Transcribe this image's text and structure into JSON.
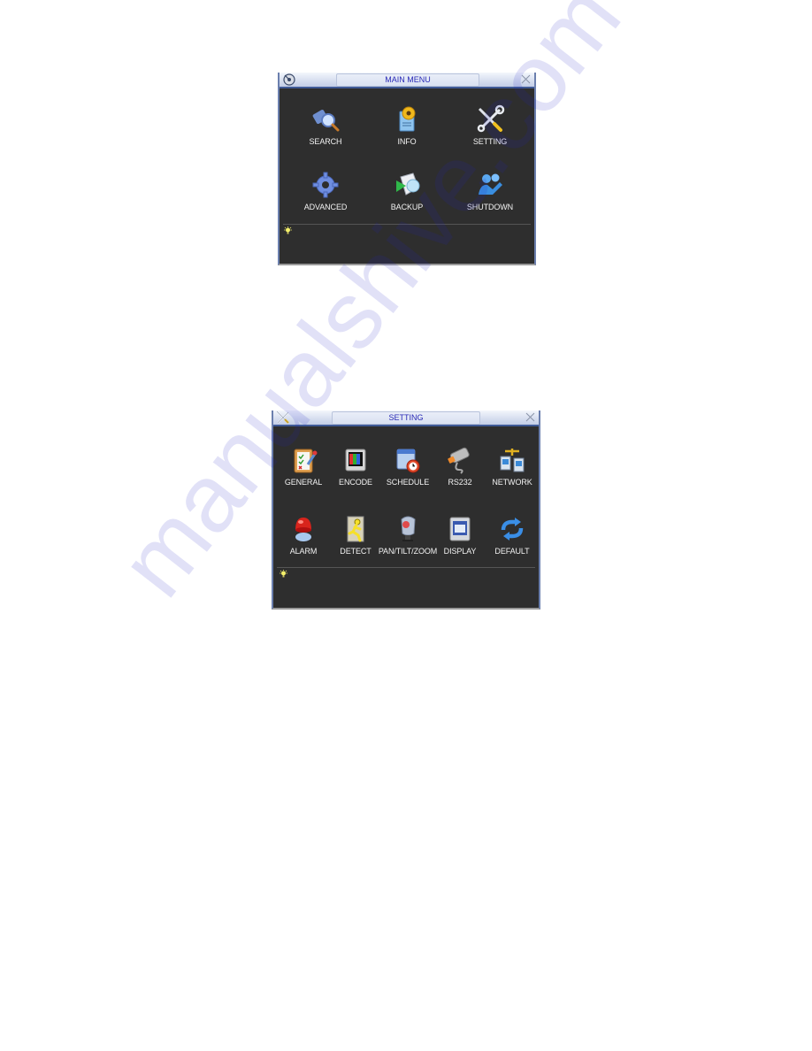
{
  "main_menu": {
    "title": "MAIN MENU",
    "title_icon": "disc-icon",
    "close_icon": "close-icon",
    "items": [
      {
        "label": "SEARCH",
        "icon": "search-film-icon"
      },
      {
        "label": "INFO",
        "icon": "info-gear-document-icon"
      },
      {
        "label": "SETTING",
        "icon": "tools-icon"
      },
      {
        "label": "ADVANCED",
        "icon": "gear-icon"
      },
      {
        "label": "BACKUP",
        "icon": "backup-disc-icon"
      },
      {
        "label": "SHUTDOWN",
        "icon": "users-shutdown-icon"
      }
    ],
    "hint_icon": "lightbulb-icon",
    "hint_text": ""
  },
  "setting_menu": {
    "title": "SETTING",
    "title_icon": "tools-icon",
    "close_icon": "close-icon",
    "items": [
      {
        "label": "GENERAL",
        "icon": "clipboard-icon"
      },
      {
        "label": "ENCODE",
        "icon": "color-bars-monitor-icon"
      },
      {
        "label": "SCHEDULE",
        "icon": "calendar-clock-icon"
      },
      {
        "label": "RS232",
        "icon": "serial-cable-icon"
      },
      {
        "label": "NETWORK",
        "icon": "network-computers-icon"
      },
      {
        "label": "ALARM",
        "icon": "alarm-siren-icon"
      },
      {
        "label": "DETECT",
        "icon": "running-man-icon"
      },
      {
        "label": "PAN/TILT/ZOOM",
        "icon": "ptz-camera-icon"
      },
      {
        "label": "DISPLAY",
        "icon": "display-window-icon"
      },
      {
        "label": "DEFAULT",
        "icon": "refresh-arrows-icon"
      }
    ],
    "hint_icon": "lightbulb-icon",
    "hint_text": ""
  },
  "watermark": "manualshive.com",
  "colors": {
    "panel_bg": "#2e2e2e",
    "title_text": "#2a2ab6",
    "label_text": "#f2f2f2",
    "titlebar_accent": "#3f5a96"
  }
}
